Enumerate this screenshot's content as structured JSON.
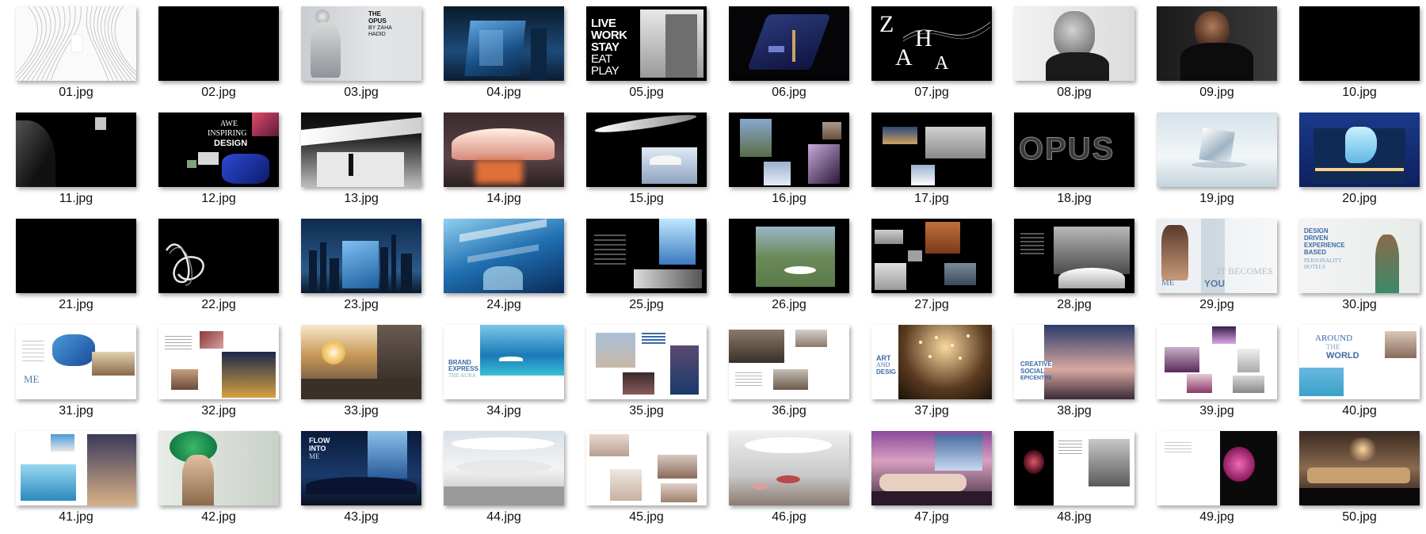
{
  "files": [
    {
      "name": "01.jpg",
      "theme": "white-contour-lines"
    },
    {
      "name": "02.jpg",
      "theme": "black"
    },
    {
      "name": "03.jpg",
      "theme": "fashion-woman",
      "text": "THE OPUS BY ZAHA HADID"
    },
    {
      "name": "04.jpg",
      "theme": "glass-tower-night"
    },
    {
      "name": "05.jpg",
      "theme": "live-work-stay",
      "lines": [
        "LIVE",
        "WORK",
        "STAY",
        "EAT",
        "PLAY"
      ]
    },
    {
      "name": "06.jpg",
      "theme": "dark-city-model"
    },
    {
      "name": "07.jpg",
      "theme": "zaha-letters",
      "text": "Z A H A"
    },
    {
      "name": "08.jpg",
      "theme": "portrait-bw"
    },
    {
      "name": "09.jpg",
      "theme": "portrait-dark"
    },
    {
      "name": "10.jpg",
      "theme": "black"
    },
    {
      "name": "11.jpg",
      "theme": "black-curves"
    },
    {
      "name": "12.jpg",
      "theme": "awe-inspiring",
      "text": "AWE INSPIRING DESIGN"
    },
    {
      "name": "13.jpg",
      "theme": "white-interior"
    },
    {
      "name": "14.jpg",
      "theme": "canopy-dusk"
    },
    {
      "name": "15.jpg",
      "theme": "wave-structure"
    },
    {
      "name": "16.jpg",
      "theme": "collage-dark"
    },
    {
      "name": "17.jpg",
      "theme": "collage-dark-2"
    },
    {
      "name": "18.jpg",
      "theme": "opus-letters",
      "text": "OPUS"
    },
    {
      "name": "19.jpg",
      "theme": "ice-cube"
    },
    {
      "name": "20.jpg",
      "theme": "opus-building-blue"
    },
    {
      "name": "21.jpg",
      "theme": "black"
    },
    {
      "name": "22.jpg",
      "theme": "white-ribbon"
    },
    {
      "name": "23.jpg",
      "theme": "skyline-night"
    },
    {
      "name": "24.jpg",
      "theme": "blue-atrium"
    },
    {
      "name": "25.jpg",
      "theme": "dark-text-glass"
    },
    {
      "name": "26.jpg",
      "theme": "aerial-green"
    },
    {
      "name": "27.jpg",
      "theme": "collage-buildings"
    },
    {
      "name": "28.jpg",
      "theme": "bw-building"
    },
    {
      "name": "29.jpg",
      "theme": "me-you",
      "text": "ME IT BECOMES YOU"
    },
    {
      "name": "30.jpg",
      "theme": "design-driven",
      "lines": [
        "DESIGN",
        "DRIVEN",
        "EXPERIENCE",
        "BASED"
      ]
    },
    {
      "name": "31.jpg",
      "theme": "me-table",
      "text": "ME"
    },
    {
      "name": "32.jpg",
      "theme": "collage-light"
    },
    {
      "name": "33.jpg",
      "theme": "terrace-sunset"
    },
    {
      "name": "34.jpg",
      "theme": "brand-pool",
      "text": "BRAND EXPRESS THE AURA"
    },
    {
      "name": "35.jpg",
      "theme": "collage-people"
    },
    {
      "name": "36.jpg",
      "theme": "hotel-rooms"
    },
    {
      "name": "37.jpg",
      "theme": "art-design-lights",
      "text": "ART AND DESIGN"
    },
    {
      "name": "38.jpg",
      "theme": "creative-social",
      "text": "CREATIVE SOCIAL EPICENTRE"
    },
    {
      "name": "39.jpg",
      "theme": "collage-light-2"
    },
    {
      "name": "40.jpg",
      "theme": "around-the-world",
      "text": "AROUND THE WORLD"
    },
    {
      "name": "41.jpg",
      "theme": "collage-pool"
    },
    {
      "name": "42.jpg",
      "theme": "green-hair-woman"
    },
    {
      "name": "43.jpg",
      "theme": "flow-into",
      "text": "FLOW INTO"
    },
    {
      "name": "44.jpg",
      "theme": "white-atrium"
    },
    {
      "name": "45.jpg",
      "theme": "collage-interiors"
    },
    {
      "name": "46.jpg",
      "theme": "restaurant-white"
    },
    {
      "name": "47.jpg",
      "theme": "bedroom-purple"
    },
    {
      "name": "48.jpg",
      "theme": "dark-flower"
    },
    {
      "name": "49.jpg",
      "theme": "white-pink-flower"
    },
    {
      "name": "50.jpg",
      "theme": "dark-suite"
    }
  ]
}
